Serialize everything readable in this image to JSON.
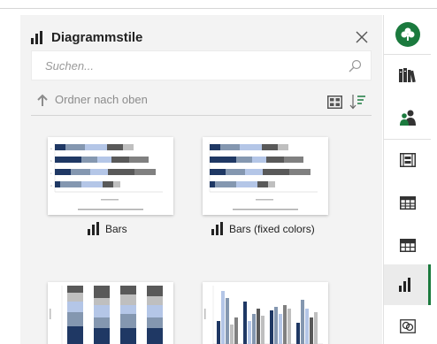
{
  "panel": {
    "title": "Diagrammstile",
    "search_placeholder": "Suchen...",
    "folder_up_label": "Ordner nach oben"
  },
  "tiles": [
    {
      "label": "Bars"
    },
    {
      "label": "Bars (fixed colors)"
    }
  ],
  "icons": {
    "chart": "bar-chart-icon",
    "close": "close-icon",
    "search": "search-icon",
    "up": "arrow-up-icon",
    "grid_view": "grid-view-icon",
    "sort": "sort-icon",
    "rail": [
      "shamrock-icon",
      "books-icon",
      "people-icon",
      "filmstrip-icon",
      "table-icon",
      "table-header-icon",
      "bar-chart-icon",
      "image-cluster-icon"
    ]
  },
  "colors": {
    "accent_green": "#1b7a3e",
    "navy": "#1f3864",
    "steel_blue": "#8497b0",
    "light_blue": "#b4c6e7",
    "grey": "#808080",
    "dark_grey": "#595959"
  }
}
